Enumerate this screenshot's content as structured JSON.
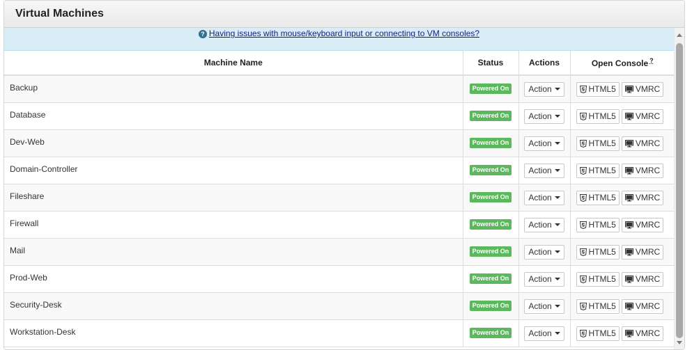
{
  "panel": {
    "title": "Virtual Machines"
  },
  "notice": {
    "icon": "question-circle-icon",
    "link_text": "Having issues with mouse/keyboard input or connecting to VM consoles?"
  },
  "table": {
    "columns": {
      "name": "Machine Name",
      "status": "Status",
      "actions": "Actions",
      "console": "Open Console",
      "console_help": "?"
    },
    "rows": [
      {
        "name": "Backup",
        "status": "Powered On",
        "action": "Action",
        "html5": "HTML5",
        "vmrc": "VMRC"
      },
      {
        "name": "Database",
        "status": "Powered On",
        "action": "Action",
        "html5": "HTML5",
        "vmrc": "VMRC"
      },
      {
        "name": "Dev-Web",
        "status": "Powered On",
        "action": "Action",
        "html5": "HTML5",
        "vmrc": "VMRC"
      },
      {
        "name": "Domain-Controller",
        "status": "Powered On",
        "action": "Action",
        "html5": "HTML5",
        "vmrc": "VMRC"
      },
      {
        "name": "Fileshare",
        "status": "Powered On",
        "action": "Action",
        "html5": "HTML5",
        "vmrc": "VMRC"
      },
      {
        "name": "Firewall",
        "status": "Powered On",
        "action": "Action",
        "html5": "HTML5",
        "vmrc": "VMRC"
      },
      {
        "name": "Mail",
        "status": "Powered On",
        "action": "Action",
        "html5": "HTML5",
        "vmrc": "VMRC"
      },
      {
        "name": "Prod-Web",
        "status": "Powered On",
        "action": "Action",
        "html5": "HTML5",
        "vmrc": "VMRC"
      },
      {
        "name": "Security-Desk",
        "status": "Powered On",
        "action": "Action",
        "html5": "HTML5",
        "vmrc": "VMRC"
      },
      {
        "name": "Workstation-Desk",
        "status": "Powered On",
        "action": "Action",
        "html5": "HTML5",
        "vmrc": "VMRC"
      }
    ]
  },
  "colors": {
    "status_on": "#5cb85c",
    "notice_bg": "#d9edf7",
    "link": "#1a1a80"
  },
  "icons": {
    "html5": "html5-icon",
    "vmrc": "monitor-icon",
    "dropdown": "caret-down-icon"
  }
}
